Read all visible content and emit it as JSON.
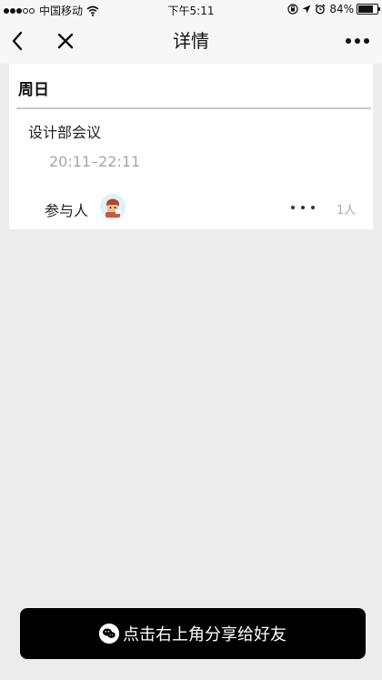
{
  "status_bar": {
    "carrier": "中国移动",
    "time": "下午5:11",
    "battery_percent": "84%",
    "battery_level": 0.84
  },
  "nav": {
    "title": "详情"
  },
  "card": {
    "day": "周日",
    "event_title": "设计部会议",
    "event_time": "20:11–22:11",
    "participants_label": "参与人",
    "participants_count": "1人"
  },
  "share_banner": {
    "text": "点击右上角分享给好友"
  },
  "colors": {
    "background": "#ececec",
    "card": "#ffffff",
    "banner": "#000000",
    "muted_text": "#a6a6a6"
  }
}
